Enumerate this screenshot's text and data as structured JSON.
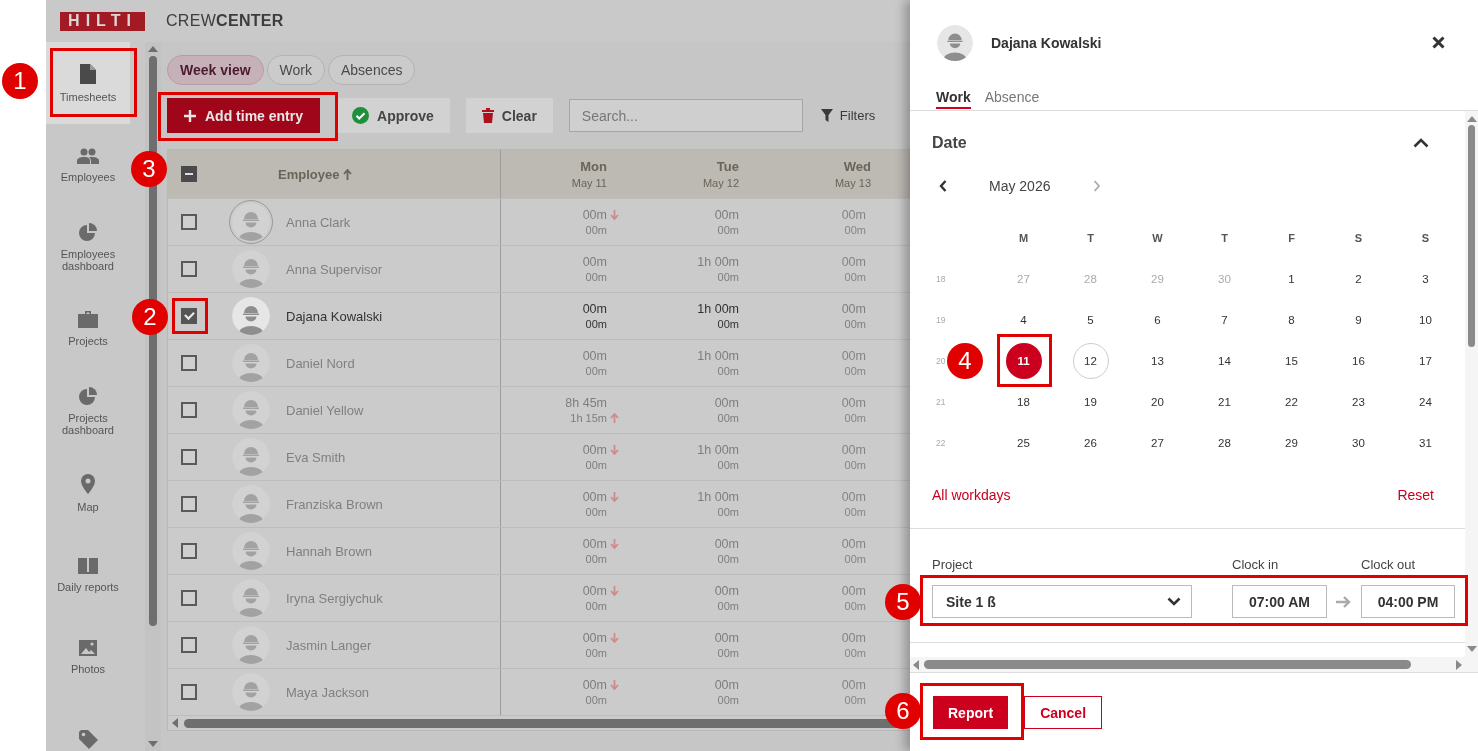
{
  "header": {
    "logo": "HILTI",
    "title": "CREW**CENTER**"
  },
  "sidebar": {
    "items": [
      {
        "label": "Timesheets",
        "selected": true
      },
      {
        "label": "Employees",
        "selected": false
      },
      {
        "label": "Employees dashboard",
        "selected": false
      },
      {
        "label": "Projects",
        "selected": false
      },
      {
        "label": "Projects dashboard",
        "selected": false
      },
      {
        "label": "Map",
        "selected": false
      },
      {
        "label": "Daily reports",
        "selected": false
      },
      {
        "label": "Photos",
        "selected": false
      },
      {
        "selected": false
      }
    ]
  },
  "view_tabs": [
    {
      "label": "Week view",
      "selected": true
    },
    {
      "label": "Work",
      "selected": false
    },
    {
      "label": "Absences",
      "selected": false
    }
  ],
  "toolbar": {
    "add_button": "Add time entry",
    "approve_button": "Approve",
    "clear_button": "Clear",
    "search": {
      "placeholder": "Search..."
    },
    "filters_button": "Filters"
  },
  "table": {
    "header_checkbox": {
      "indeterminate": true
    },
    "employee_column": {
      "label": "Employee",
      "sorted": true
    },
    "days": [
      {
        "day": "Mon",
        "date": "May 11"
      },
      {
        "day": "Tue",
        "date": "May 12"
      },
      {
        "day": "Wed",
        "date": "May 13"
      }
    ],
    "rows": [
      {
        "name": "Anna Clark",
        "selected": false,
        "focused": true,
        "cells": [
          {
            "top": "00m",
            "bottom": "00m",
            "down": true,
            "up": false
          },
          {
            "top": "00m",
            "bottom": "00m",
            "down": false,
            "up": false
          },
          {
            "top": "00m",
            "bottom": "00m",
            "down": false,
            "up": false
          }
        ]
      },
      {
        "name": "Anna Supervisor",
        "selected": false,
        "focused": false,
        "cells": [
          {
            "top": "00m",
            "bottom": "00m",
            "down": false,
            "up": false
          },
          {
            "top": "1h 00m",
            "bottom": "00m",
            "down": false,
            "up": false
          },
          {
            "top": "00m",
            "bottom": "00m",
            "down": false,
            "up": false
          }
        ]
      },
      {
        "name": "Dajana Kowalski",
        "selected": true,
        "focused": false,
        "cells": [
          {
            "top": "00m",
            "bottom": "00m",
            "down": false,
            "up": false
          },
          {
            "top": "1h 00m",
            "bottom": "00m",
            "down": false,
            "up": false
          },
          {
            "top": "00m",
            "bottom": "00m",
            "down": false,
            "up": false
          }
        ]
      },
      {
        "name": "Daniel Nord",
        "selected": false,
        "focused": false,
        "cells": [
          {
            "top": "00m",
            "bottom": "00m",
            "down": false,
            "up": false
          },
          {
            "top": "1h 00m",
            "bottom": "00m",
            "down": false,
            "up": false
          },
          {
            "top": "00m",
            "bottom": "00m",
            "down": false,
            "up": false
          }
        ]
      },
      {
        "name": "Daniel Yellow",
        "selected": false,
        "focused": false,
        "cells": [
          {
            "top": "8h 45m",
            "bottom": "1h 15m",
            "down": false,
            "up": true
          },
          {
            "top": "00m",
            "bottom": "00m",
            "down": false,
            "up": false
          },
          {
            "top": "00m",
            "bottom": "00m",
            "down": false,
            "up": false
          }
        ]
      },
      {
        "name": "Eva Smith",
        "selected": false,
        "focused": false,
        "cells": [
          {
            "top": "00m",
            "bottom": "00m",
            "down": true,
            "up": false
          },
          {
            "top": "1h 00m",
            "bottom": "00m",
            "down": false,
            "up": false
          },
          {
            "top": "00m",
            "bottom": "00m",
            "down": false,
            "up": false
          }
        ]
      },
      {
        "name": "Franziska Brown",
        "selected": false,
        "focused": false,
        "cells": [
          {
            "top": "00m",
            "bottom": "00m",
            "down": true,
            "up": false
          },
          {
            "top": "1h 00m",
            "bottom": "00m",
            "down": false,
            "up": false
          },
          {
            "top": "00m",
            "bottom": "00m",
            "down": false,
            "up": false
          }
        ]
      },
      {
        "name": "Hannah Brown",
        "selected": false,
        "focused": false,
        "cells": [
          {
            "top": "00m",
            "bottom": "00m",
            "down": true,
            "up": false
          },
          {
            "top": "00m",
            "bottom": "00m",
            "down": false,
            "up": false
          },
          {
            "top": "00m",
            "bottom": "00m",
            "down": false,
            "up": false
          }
        ]
      },
      {
        "name": "Iryna Sergiychuk",
        "selected": false,
        "focused": false,
        "cells": [
          {
            "top": "00m",
            "bottom": "00m",
            "down": true,
            "up": false
          },
          {
            "top": "00m",
            "bottom": "00m",
            "down": false,
            "up": false
          },
          {
            "top": "00m",
            "bottom": "00m",
            "down": false,
            "up": false
          }
        ]
      },
      {
        "name": "Jasmin Langer",
        "selected": false,
        "focused": false,
        "cells": [
          {
            "top": "00m",
            "bottom": "00m",
            "down": true,
            "up": false
          },
          {
            "top": "00m",
            "bottom": "00m",
            "down": false,
            "up": false
          },
          {
            "top": "00m",
            "bottom": "00m",
            "down": false,
            "up": false
          }
        ]
      },
      {
        "name": "Maya Jackson",
        "selected": false,
        "focused": false,
        "cells": [
          {
            "top": "00m",
            "bottom": "00m",
            "down": true,
            "up": false
          },
          {
            "top": "00m",
            "bottom": "00m",
            "down": false,
            "up": false
          },
          {
            "top": "00m",
            "bottom": "00m",
            "down": false,
            "up": false
          }
        ]
      }
    ]
  },
  "panel": {
    "employee": "Dajana Kowalski",
    "tabs": [
      {
        "label": "Work",
        "selected": true
      },
      {
        "label": "Absence",
        "selected": false
      }
    ],
    "date_section": {
      "title": "Date",
      "expanded": true
    },
    "calendar": {
      "month": "May 2026",
      "prev_enabled": true,
      "next_enabled": false,
      "weekdays": [
        "M",
        "T",
        "W",
        "T",
        "F",
        "S",
        "S"
      ],
      "weeks": [
        {
          "number": "18",
          "days": [
            {
              "label": "27",
              "outside": true,
              "selected": false,
              "today": false
            },
            {
              "label": "28",
              "outside": true,
              "selected": false,
              "today": false
            },
            {
              "label": "29",
              "outside": true,
              "selected": false,
              "today": false
            },
            {
              "label": "30",
              "outside": true,
              "selected": false,
              "today": false
            },
            {
              "label": "1",
              "outside": false,
              "selected": false,
              "today": false
            },
            {
              "label": "2",
              "outside": false,
              "selected": false,
              "today": false
            },
            {
              "label": "3",
              "outside": false,
              "selected": false,
              "today": false
            }
          ]
        },
        {
          "number": "19",
          "days": [
            {
              "label": "4",
              "outside": false,
              "selected": false,
              "today": false
            },
            {
              "label": "5",
              "outside": false,
              "selected": false,
              "today": false
            },
            {
              "label": "6",
              "outside": false,
              "selected": false,
              "today": false
            },
            {
              "label": "7",
              "outside": false,
              "selected": false,
              "today": false
            },
            {
              "label": "8",
              "outside": false,
              "selected": false,
              "today": false
            },
            {
              "label": "9",
              "outside": false,
              "selected": false,
              "today": false
            },
            {
              "label": "10",
              "outside": false,
              "selected": false,
              "today": false
            }
          ]
        },
        {
          "number": "20",
          "days": [
            {
              "label": "11",
              "outside": false,
              "selected": true,
              "today": false
            },
            {
              "label": "12",
              "outside": false,
              "selected": false,
              "today": true
            },
            {
              "label": "13",
              "outside": false,
              "selected": false,
              "today": false
            },
            {
              "label": "14",
              "outside": false,
              "selected": false,
              "today": false
            },
            {
              "label": "15",
              "outside": false,
              "selected": false,
              "today": false
            },
            {
              "label": "16",
              "outside": false,
              "selected": false,
              "today": false
            },
            {
              "label": "17",
              "outside": false,
              "selected": false,
              "today": false
            }
          ]
        },
        {
          "number": "21",
          "days": [
            {
              "label": "18",
              "outside": false,
              "selected": false,
              "today": false
            },
            {
              "label": "19",
              "outside": false,
              "selected": false,
              "today": false
            },
            {
              "label": "20",
              "outside": false,
              "selected": false,
              "today": false
            },
            {
              "label": "21",
              "outside": false,
              "selected": false,
              "today": false
            },
            {
              "label": "22",
              "outside": false,
              "selected": false,
              "today": false
            },
            {
              "label": "23",
              "outside": false,
              "selected": false,
              "today": false
            },
            {
              "label": "24",
              "outside": false,
              "selected": false,
              "today": false
            }
          ]
        },
        {
          "number": "22",
          "days": [
            {
              "label": "25",
              "outside": false,
              "selected": false,
              "today": false
            },
            {
              "label": "26",
              "outside": false,
              "selected": false,
              "today": false
            },
            {
              "label": "27",
              "outside": false,
              "selected": false,
              "today": false
            },
            {
              "label": "28",
              "outside": false,
              "selected": false,
              "today": false
            },
            {
              "label": "29",
              "outside": false,
              "selected": false,
              "today": false
            },
            {
              "label": "30",
              "outside": false,
              "selected": false,
              "today": false
            },
            {
              "label": "31",
              "outside": false,
              "selected": false,
              "today": false
            }
          ]
        }
      ]
    },
    "all_workdays_link": "All workdays",
    "reset_link": "Reset",
    "project": {
      "label": "Project",
      "value": "Site 1 ß"
    },
    "clock_in": {
      "label": "Clock in",
      "value": "07:00 AM"
    },
    "clock_out": {
      "label": "Clock out",
      "value": "04:00 PM"
    },
    "buttons": [
      {
        "label": "Report",
        "kind": "primary"
      },
      {
        "label": "Cancel",
        "kind": "secondary"
      }
    ]
  },
  "annotations": [
    {
      "number": "1"
    },
    {
      "number": "2"
    },
    {
      "number": "3"
    },
    {
      "number": "4"
    },
    {
      "number": "5"
    },
    {
      "number": "6"
    }
  ]
}
